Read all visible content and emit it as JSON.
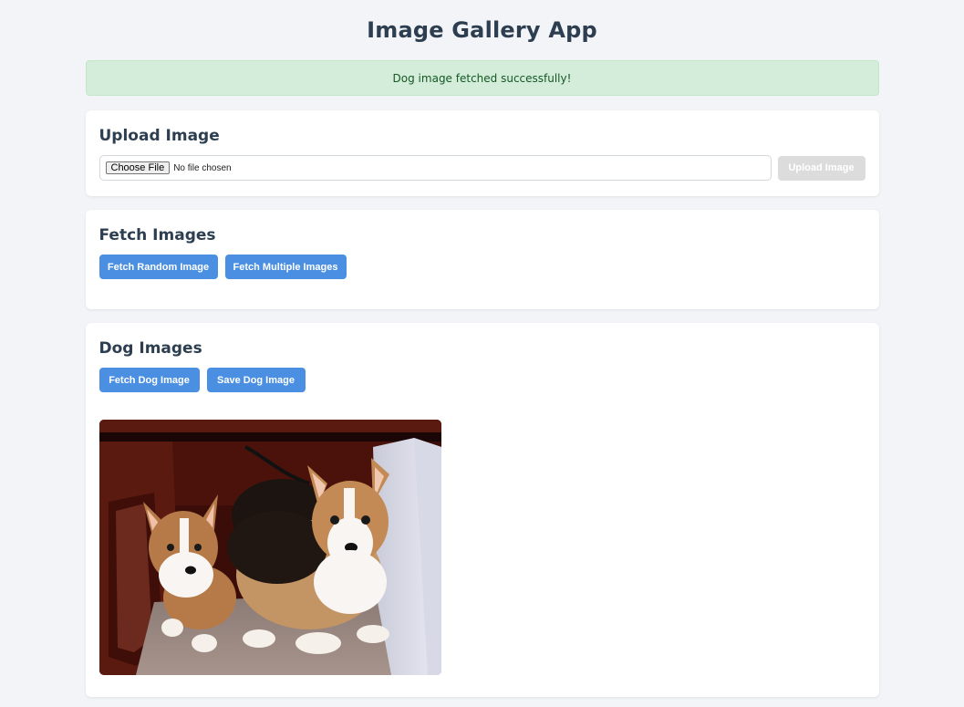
{
  "header": {
    "title": "Image Gallery App"
  },
  "alert": {
    "message": "Dog image fetched successfully!"
  },
  "upload": {
    "heading": "Upload Image",
    "choose_label": "Choose File",
    "file_status": "No file chosen",
    "upload_label": "Upload Image"
  },
  "fetch": {
    "heading": "Fetch Images",
    "random_label": "Fetch Random Image",
    "multiple_label": "Fetch Multiple Images"
  },
  "dog": {
    "heading": "Dog Images",
    "fetch_label": "Fetch Dog Image",
    "save_label": "Save Dog Image"
  },
  "colors": {
    "accent": "#4a8fe1",
    "success_bg": "#d4edda",
    "success_text": "#155724",
    "disabled": "#dcdcdc"
  }
}
